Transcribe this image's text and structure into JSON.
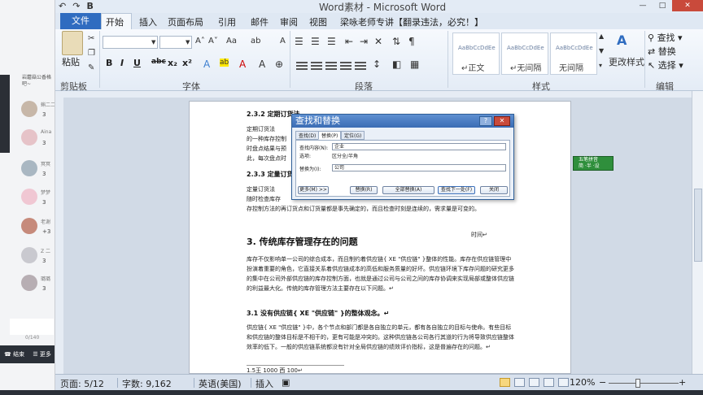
{
  "chat": {
    "header_snippet": "岩蘑菇公香格吧~",
    "items": [
      {
        "name": "蝌二二",
        "count": "3",
        "avatar_color": "#c7b7a8"
      },
      {
        "name": "Aina",
        "count": "3",
        "avatar_color": "#e6c3c8"
      },
      {
        "name": "冥冥",
        "count": "3",
        "avatar_color": "#a9b7c2"
      },
      {
        "name": "梦梦",
        "count": "3",
        "avatar_color": "#f0c7d3"
      },
      {
        "name": "老谢",
        "count": "+3",
        "avatar_color": "#c68a7b"
      },
      {
        "name": "Z 二",
        "count": "3",
        "avatar_color": "#c9c9cf"
      },
      {
        "name": "璐璐",
        "count": "3",
        "avatar_color": "#b7aeb3"
      }
    ],
    "input_count": "0/140",
    "footer": {
      "end_label": "结束",
      "more_label": "更多"
    }
  },
  "window": {
    "title": "Word素材 - Microsoft Word",
    "qat": [
      "↶",
      "↷",
      "B"
    ],
    "controls": [
      "—",
      "□",
      "✕"
    ]
  },
  "tabs": {
    "file": "文件",
    "items": [
      "开始",
      "插入",
      "页面布局",
      "引用",
      "邮件",
      "审阅",
      "视图",
      "梁咏老师专讲【翻录违法，必究！】"
    ]
  },
  "ribbon": {
    "clipboard": {
      "paste": "粘贴",
      "label": "剪贴板"
    },
    "font": {
      "label": "字体",
      "buttons": [
        "B",
        "I",
        "U",
        "abc",
        "x₂",
        "x²"
      ],
      "top": [
        "A˄",
        "A˅",
        "Aa",
        "ab",
        "A"
      ]
    },
    "paragraph": {
      "label": "段落"
    },
    "styles": {
      "label": "样式",
      "items": [
        {
          "sample": "AaBbCcDdEe",
          "name": "↵正文"
        },
        {
          "sample": "AaBbCcDdEe",
          "name": "↵无间隔"
        },
        {
          "sample": "AaBbCcDdEe",
          "name": "无间隔"
        }
      ],
      "change": "更改样式"
    },
    "editing": {
      "label": "编辑",
      "find": "查找",
      "replace": "替换",
      "select": "选择"
    }
  },
  "document": {
    "h232": "2.3.2 定期订货法",
    "p1": [
      "定期订货法",
      "的一种库存控制",
      "时盘点结果与预",
      "此，每次盘点时"
    ],
    "h233": "2.3.3 定量订货",
    "p2": [
      "定量订货法",
      "随时检查库存"
    ],
    "p2_tail": "存控制方法的再订货点和订货量都是事先确定的，而且检查时刻是连续的，需求量是可变的。",
    "time": "时间↵",
    "h3": "3. 传统库存管理存在的问题",
    "p3": "库存不仅影响单一公司的综合成本，而且制约着供应链{ XE \"供应链\" }整体的性能。库存在供应链管理中扮演着重要的角色，它直接关系着供应链成本的高低和服务质量的好坏。供应链环境下库存问题的研究更多的集中在公司外部供应链的库存控制方面，也就是通过公司与公司之间的库存协调来实现局部或整体供应链的利益最大化。传统的库存管理方法主要存在以下问题。↵",
    "h31": "3.1 没有供应链{ XE \"供应链\" }的整体观念。↵",
    "p4": "供应链{ XE \"供应链\" }中，各个节点和部门都是各自独立的单元，都有各自独立的目标与使命。有些目标和供应链的整体目标是不相干的，更有可能是冲突的。这种供应链各公司各行其道的行为将导致供应链整体效率的低下。一般的供应链系统都没有针对全局供应链的绩效评价指标，这是普遍存在的问题。↵",
    "table_frag": "1.5王  1000  西  100↵"
  },
  "dialog": {
    "title": "查找和替换",
    "tabs": [
      "查找(D)",
      "替换(P)",
      "定位(G)"
    ],
    "find_label": "查找内容(N):",
    "find_value": "企业",
    "options_label": "选项:",
    "options_value": "区分全/半角",
    "replace_label": "替换为(I):",
    "replace_value": "公司",
    "buttons": [
      "更多(M) >>",
      "替换(R)",
      "全部替换(A)",
      "查找下一处(F)",
      "关闭"
    ]
  },
  "ime": {
    "line1": "五笔拼音",
    "line2": "简 ·半 ·设"
  },
  "status": {
    "page": "页面: 5/12",
    "words": "字数: 9,162",
    "lang": "英语(美国)",
    "mode": "插入",
    "zoom": "120%",
    "zoom_level_percent": 42
  }
}
